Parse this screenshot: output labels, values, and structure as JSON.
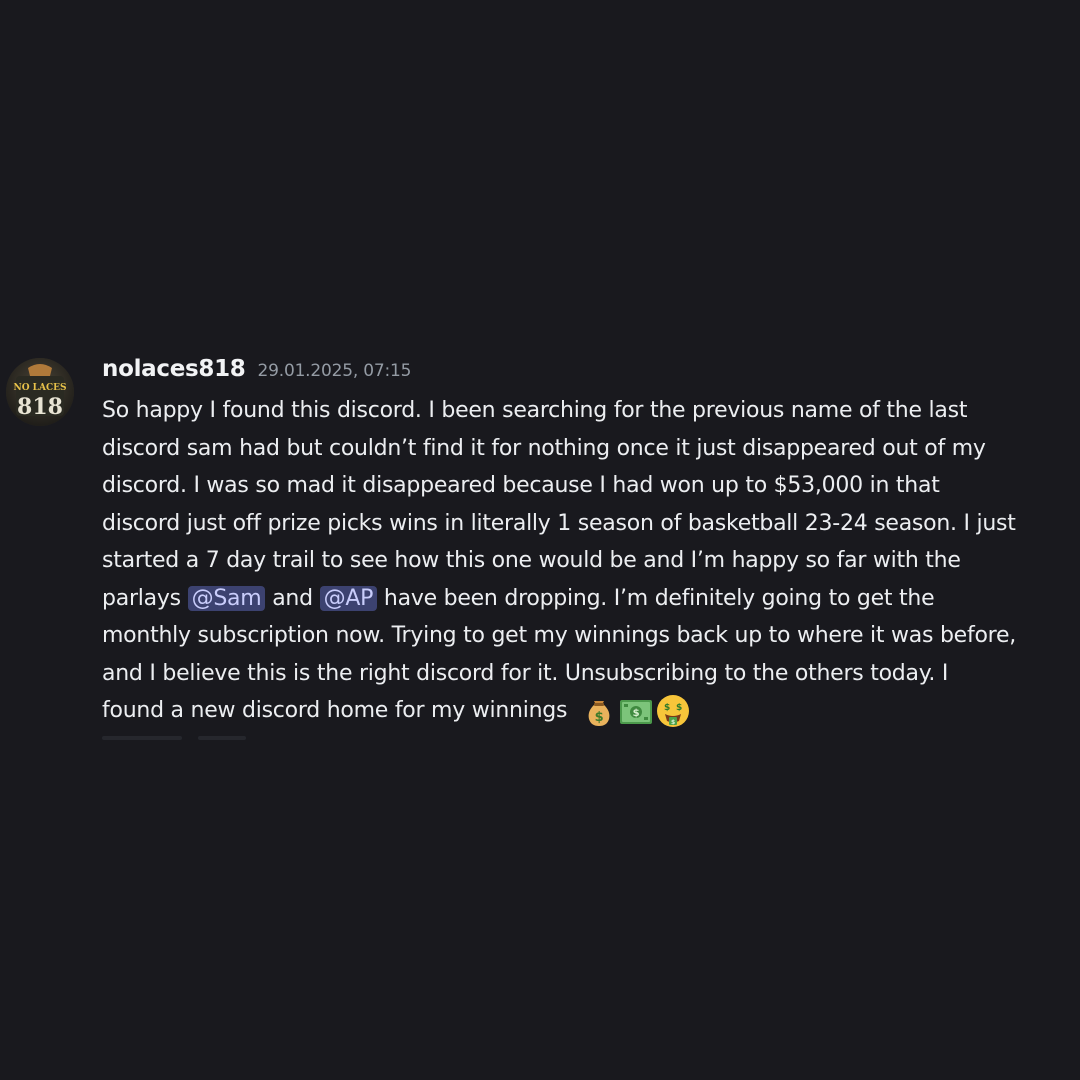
{
  "message": {
    "username": "nolaces818",
    "timestamp": "29.01.2025, 07:15",
    "avatar": {
      "icon": "avatar-image",
      "text_top": "NO LACES",
      "text_bottom": "818"
    },
    "lines": [
      "So happy I found this discord. I been searching for the previous name of the last",
      "discord sam had but couldn’t find it for nothing once it just disappeared out of my",
      "discord. I was so mad it disappeared because I had won up to $53,000 in that",
      "discord just off prize picks wins in literally 1 season of basketball 23-24 season. I just",
      "started a 7 day trail to see how this one would be and I’m happy so far with the"
    ],
    "line6": {
      "prefix": "parlays ",
      "mention1": "@Sam",
      "middle": " and ",
      "mention2": "@AP",
      "suffix": " have been dropping. I’m definitely going to get the"
    },
    "lines_after": [
      "monthly subscription now. Trying to get my winnings back up to where it was before,",
      "and I believe this is the right discord for it. Unsubscribing to the others today. I"
    ],
    "last_line": "found a new discord home for my winnings",
    "emojis": [
      "money-bag-emoji",
      "dollar-banknote-emoji",
      "money-mouth-face-emoji"
    ]
  },
  "colors": {
    "background": "#19191e",
    "mention_bg": "#3c4270",
    "mention_text": "#c9cdfb",
    "timestamp": "#949ba4"
  }
}
